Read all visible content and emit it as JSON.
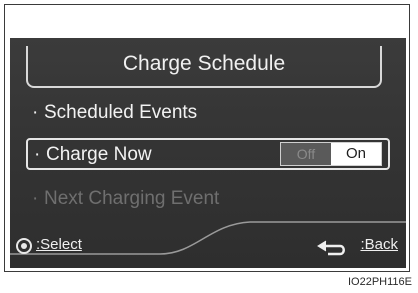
{
  "screen": {
    "title": "Charge Schedule",
    "items": [
      {
        "bullet": "·",
        "label": "Scheduled Events"
      },
      {
        "bullet": "·",
        "label": "Charge Now",
        "toggle": {
          "off": "Off",
          "on": "On",
          "selected": "On"
        }
      },
      {
        "bullet": "·",
        "label": "Next Charging Event",
        "disabled": true
      }
    ],
    "footer": {
      "select_label": ":Select",
      "back_label": ":Back"
    }
  },
  "caption": "IO22PH116E"
}
